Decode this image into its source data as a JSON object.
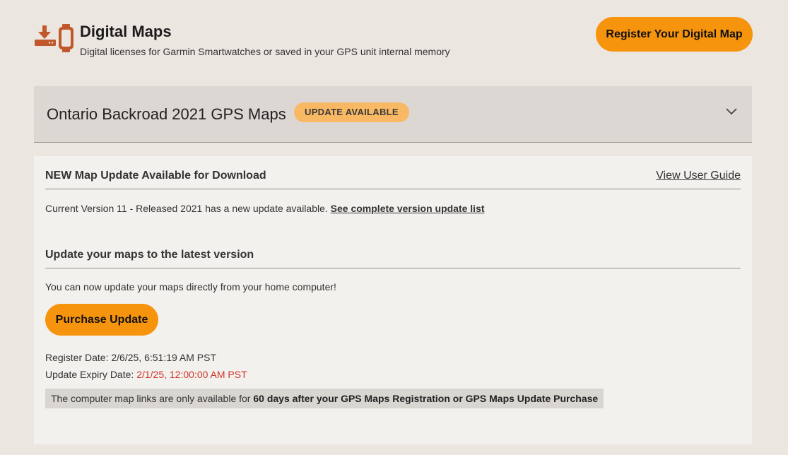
{
  "header": {
    "title": "Digital Maps",
    "subtitle": "Digital licenses for Garmin Smartwatches or saved in your GPS unit internal memory",
    "logo_icon": "download-to-device-and-watch-icon",
    "register_button": "Register Your Digital Map"
  },
  "product": {
    "name": "Ontario Backroad 2021 GPS Maps",
    "badge": "UPDATE AVAILABLE",
    "toggle_icon": "chevron-down-icon"
  },
  "update": {
    "section_title": "NEW Map Update Available for Download",
    "user_guide_link": "View User Guide",
    "version_text": "Current Version 11 - Released 2021 has a new update available.",
    "version_link": "See complete version update list",
    "update_title": "Update your maps to the latest version",
    "update_text": "You can now update your maps directly from your home computer!",
    "purchase_button": "Purchase Update",
    "register_date_label": "Register Date:",
    "register_date_value": "2/6/25, 6:51:19 AM PST",
    "expiry_label": "Update Expiry Date:",
    "expiry_value": "2/1/25, 12:00:00 AM PST",
    "notice_prefix": "The computer map links are only available for",
    "notice_bold": "60 days after your GPS Maps Registration or GPS Maps Update Purchase"
  },
  "colors": {
    "accent": "#f7940d",
    "badge": "#f9b863",
    "icon": "#c0582b",
    "expiry": "#d0342c"
  }
}
